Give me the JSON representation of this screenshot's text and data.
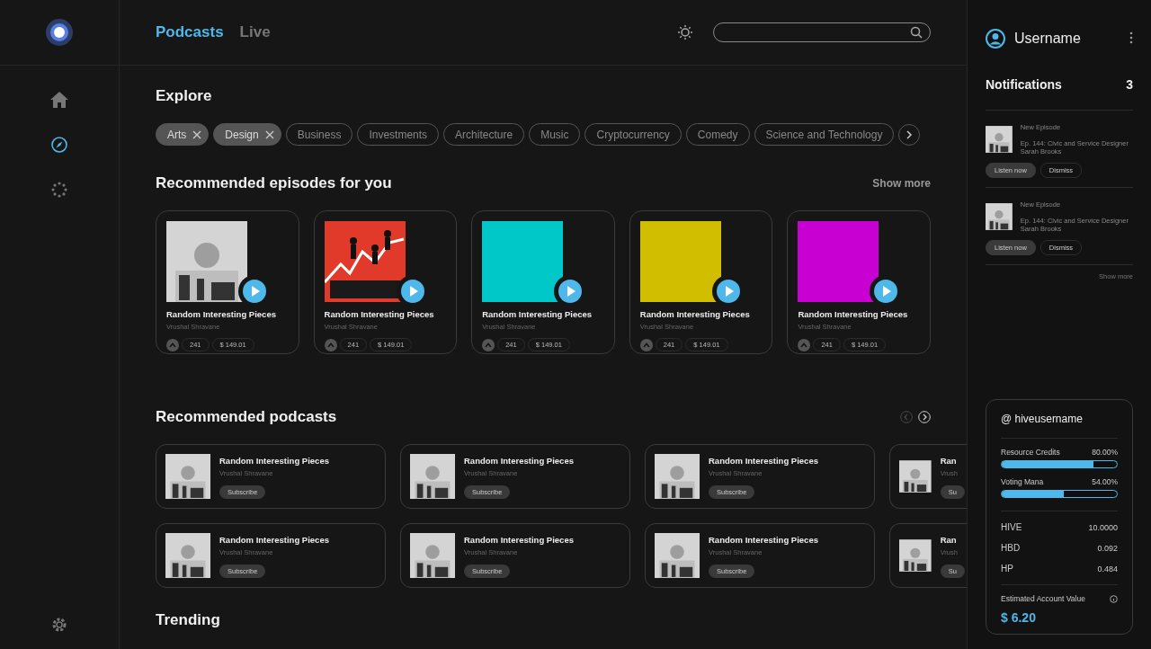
{
  "nav": {
    "tabs": [
      {
        "label": "Podcasts",
        "selected": true
      },
      {
        "label": "Live",
        "selected": false
      }
    ],
    "rail": [
      {
        "kind": "home",
        "selected": false
      },
      {
        "kind": "explore",
        "selected": true
      },
      {
        "kind": "sparkle",
        "selected": false
      }
    ]
  },
  "explore": {
    "title": "Explore",
    "chips": [
      {
        "label": "Arts",
        "selected": true
      },
      {
        "label": "Design",
        "selected": true
      },
      {
        "label": "Business",
        "selected": false
      },
      {
        "label": "Investments",
        "selected": false
      },
      {
        "label": "Architecture",
        "selected": false
      },
      {
        "label": "Music",
        "selected": false
      },
      {
        "label": "Cryptocurrency",
        "selected": false
      },
      {
        "label": "Comedy",
        "selected": false
      },
      {
        "label": "Science and Technology",
        "selected": false
      }
    ]
  },
  "episodes": {
    "title": "Recommended episodes for you",
    "more": "Show more",
    "items": [
      {
        "kind": "picture",
        "title": "Random Interesting Pieces",
        "author": "Vrushal Shravane",
        "votes": "241",
        "payout": "$ 149.01"
      },
      {
        "kind": "picture",
        "title": "Random Interesting Pieces",
        "author": "Vrushal Shravane",
        "votes": "241",
        "payout": "$ 149.01"
      },
      {
        "kind": "solid",
        "color": "#00c8c8",
        "title": "Random Interesting Pieces",
        "author": "Vrushal Shravane",
        "votes": "241",
        "payout": "$ 149.01"
      },
      {
        "kind": "solid",
        "color": "#d2be00",
        "title": "Random Interesting Pieces",
        "author": "Vrushal Shravane",
        "votes": "241",
        "payout": "$ 149.01"
      },
      {
        "kind": "solid",
        "color": "#c800d2",
        "title": "Random Interesting Pieces",
        "author": "Vrushal Shravane",
        "votes": "241",
        "payout": "$ 149.01"
      }
    ]
  },
  "podcasts": {
    "title": "Recommended podcasts",
    "prev_disabled": true,
    "rows": [
      [
        {
          "title": "Random Interesting Pieces",
          "author": "Vrushal Shravane",
          "action": "Subscribe"
        },
        {
          "title": "Random Interesting Pieces",
          "author": "Vrushal Shravane",
          "action": "Subscribe"
        },
        {
          "title": "Random Interesting Pieces",
          "author": "Vrushal Shravane",
          "action": "Subscribe"
        },
        {
          "title": "Ran",
          "author": "Vrush",
          "action": "Su"
        }
      ],
      [
        {
          "title": "Random Interesting Pieces",
          "author": "Vrushal Shravane",
          "action": "Subscribe"
        },
        {
          "title": "Random Interesting Pieces",
          "author": "Vrushal Shravane",
          "action": "Subscribe"
        },
        {
          "title": "Random Interesting Pieces",
          "author": "Vrushal Shravane",
          "action": "Subscribe"
        },
        {
          "title": "Ran",
          "author": "Vrush",
          "action": "Su"
        }
      ]
    ]
  },
  "trending": {
    "title": "Trending"
  },
  "user": {
    "name": "Username"
  },
  "notifications": {
    "title": "Notifications",
    "count": "3",
    "more": "Show more",
    "items": [
      {
        "label": "New Episode",
        "text": "Ep. 144: Civic and Service Designer Sarah Brooks",
        "primary": "Listen now",
        "secondary": "Dismiss"
      },
      {
        "label": "New Episode",
        "text": "Ep. 144: Civic and Service Designer Sarah Brooks",
        "primary": "Listen now",
        "secondary": "Dismiss"
      }
    ]
  },
  "wallet": {
    "handle": "@ hiveusername",
    "meters": [
      {
        "name": "Resource Credits",
        "reading": "80.00%",
        "level": 0.8
      },
      {
        "name": "Voting Mana",
        "reading": "54.00%",
        "level": 0.54
      }
    ],
    "balances": [
      {
        "name": "HIVE",
        "value": "10.0000"
      },
      {
        "name": "HBD",
        "value": "0.092"
      },
      {
        "name": "HP",
        "value": "0.484"
      }
    ],
    "estimate_label": "Estimated Account Value",
    "estimate": "$ 6.20"
  }
}
